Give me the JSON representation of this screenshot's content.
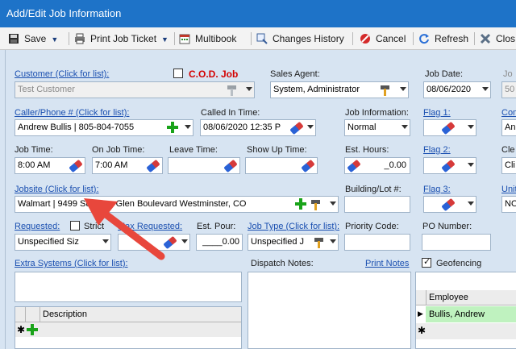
{
  "window": {
    "title": "Add/Edit Job Information"
  },
  "toolbar": {
    "save": "Save",
    "print_ticket": "Print Job Ticket",
    "multibook": "Multibook",
    "changes_history": "Changes History",
    "cancel": "Cancel",
    "refresh": "Refresh",
    "close": "Clos"
  },
  "form": {
    "customer_label": "Customer (Click for list):",
    "customer_value": "Test Customer",
    "cod_label": "C.O.D. Job",
    "sales_agent_label": "Sales Agent:",
    "sales_agent_value": "System, Administrator",
    "job_date_label": "Job Date:",
    "job_date_value": "08/06/2020",
    "job_no_label": "Jo",
    "job_no_value": "50",
    "caller_label": "Caller/Phone # (Click for list):",
    "caller_value": "Andrew Bullis | 805-804-7055",
    "called_in_label": "Called In Time:",
    "called_in_value": "08/06/2020 12:35 P",
    "job_info_label": "Job Information:",
    "job_info_value": "Normal",
    "flag1_label": "Flag 1:",
    "comp_label": "Com",
    "comp_value": "And",
    "job_time_label": "Job Time:",
    "job_time_value": "8:00 AM",
    "on_job_label": "On Job Time:",
    "on_job_value": "7:00 AM",
    "leave_label": "Leave Time:",
    "show_up_label": "Show Up Time:",
    "est_hours_label": "Est. Hours:",
    "est_hours_value": "_0.00",
    "flag2_label": "Flag 2:",
    "cle_label": "Cle",
    "cle_value": "Cli",
    "jobsite_label": "Jobsite (Click for list):",
    "jobsite_value": "Walmart | 9499 Summer Glen Boulevard Westminster, CO",
    "building_label": "Building/Lot #:",
    "flag3_label": "Flag 3:",
    "unit_label": "Unit",
    "unit_value": "NO",
    "requested_label": "Requested:",
    "strict_label": "Strict",
    "max_requested_label": "Max Requested:",
    "est_pour_label": "Est. Pour:",
    "est_pour_value": "____0.00",
    "requested_value": "Unspecified Siz",
    "job_type_label": "Job Type (Click for list):",
    "job_type_value": "Unspecified J",
    "priority_label": "Priority Code:",
    "po_label": "PO Number:",
    "extra_systems_label": "Extra Systems (Click for list):",
    "dispatch_notes_label": "Dispatch Notes:",
    "print_notes_label": "Print Notes",
    "geofencing_label": "Geofencing"
  },
  "description_grid": {
    "header": "Description"
  },
  "employee_grid": {
    "header": "Employee",
    "rows": [
      "Bullis, Andrew"
    ]
  },
  "colors": {
    "titlebar": "#1e73c8",
    "panel": "#d7e4f2",
    "link": "#1a4fb0",
    "cod_red": "#d40000",
    "arrow": "#e8473c",
    "row_highlight": "#bff2bf"
  }
}
